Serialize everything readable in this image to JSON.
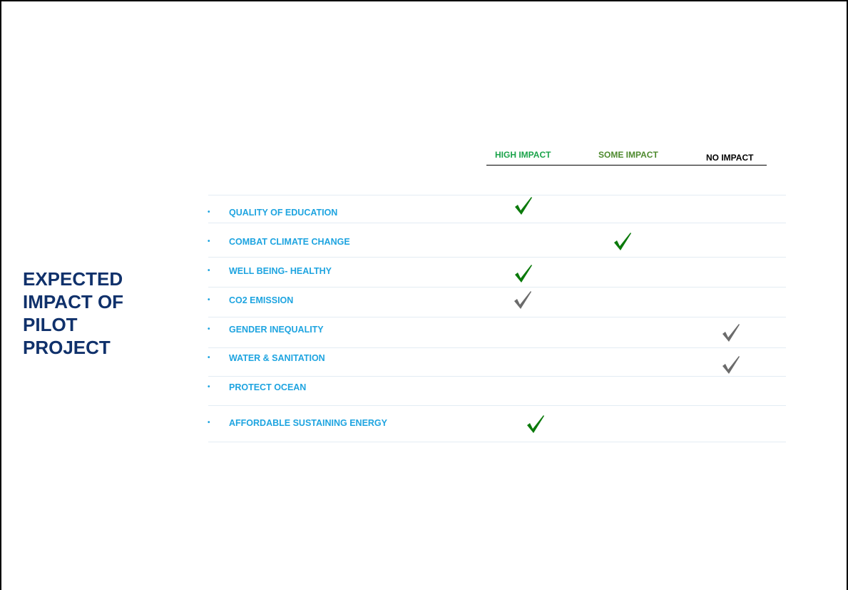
{
  "slide": {
    "title": "EXPECTED IMPACT OF PILOT PROJECT",
    "columns": {
      "high": "HIGH IMPACT",
      "some": "SOME IMPACT",
      "none": "NO IMPACT"
    },
    "bullet_char": "•",
    "items": [
      {
        "label": "QUALITY OF EDUCATION",
        "impact": "high"
      },
      {
        "label": "COMBAT CLIMATE CHANGE",
        "impact": "some"
      },
      {
        "label": "WELL BEING- HEALTHY",
        "impact": "high"
      },
      {
        "label": "CO2 EMISSION",
        "impact": "high"
      },
      {
        "label": "GENDER INEQUALITY",
        "impact": "none"
      },
      {
        "label": "WATER & SANITATION",
        "impact": "none"
      },
      {
        "label": "PROTECT OCEAN",
        "impact": null
      },
      {
        "label": "AFFORDABLE SUSTAINING ENERGY",
        "impact": "high"
      }
    ],
    "colors": {
      "title": "#10316b",
      "item_text": "#1ea4e0",
      "high_header": "#1aa34a",
      "some_header": "#4e8a2e",
      "check_green": "#0b7a0b",
      "check_gray": "#6b6b6b"
    }
  }
}
